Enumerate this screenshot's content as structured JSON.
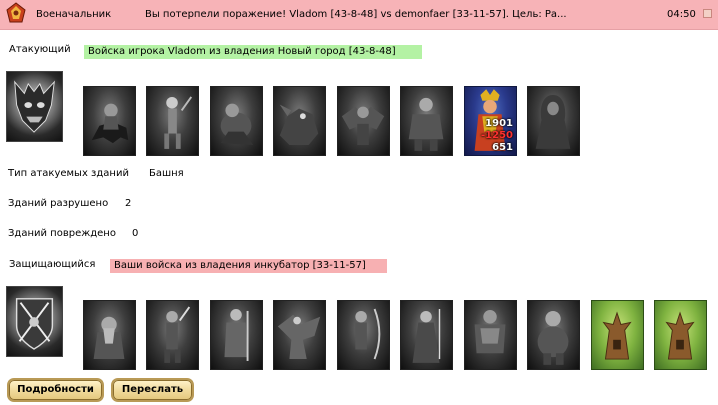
{
  "header": {
    "sender": "Военачальник",
    "subject": "Вы потерпели поражение! Vladom [43-8-48] vs demonfaer [33-11-57]. Цель: Ра...",
    "time": "04:50"
  },
  "attacker": {
    "label": "Атакующий",
    "title": "Войска игрока Vladom из владения Новый город [43-8-48]",
    "hero_icon": "demon-skull-crest",
    "units": [
      {
        "icon": "undead-rider"
      },
      {
        "icon": "skeleton-warrior"
      },
      {
        "icon": "ghoul"
      },
      {
        "icon": "undead-hound"
      },
      {
        "icon": "gargoyle"
      },
      {
        "icon": "brute"
      },
      {
        "icon": "armored-knight"
      },
      {
        "icon": "witch-queen",
        "stats": [
          "1901",
          "-1250",
          "651"
        ]
      },
      {
        "icon": "shade-wraith"
      }
    ]
  },
  "info": {
    "building_type_label": "Тип атакуемых зданий",
    "building_type_value": "Башня",
    "destroyed_label": "Зданий разрушено",
    "destroyed_value": "2",
    "damaged_label": "Зданий повреждено",
    "damaged_value": "0"
  },
  "defender": {
    "label": "Защищающийся",
    "title": "Ваши войска из владения инкубатор [33-11-57]",
    "hero_icon": "crossed-swords-crest",
    "units": [
      {
        "icon": "dwarf-warrior"
      },
      {
        "icon": "swordsman"
      },
      {
        "icon": "paladin"
      },
      {
        "icon": "griffin"
      },
      {
        "icon": "archer"
      },
      {
        "icon": "elf-mage"
      },
      {
        "icon": "heavy-knight"
      },
      {
        "icon": "ogre"
      },
      {
        "icon": "tree-tower"
      },
      {
        "icon": "tree-tower"
      }
    ]
  },
  "buttons": {
    "details": "Подробности",
    "forward": "Переслать"
  }
}
